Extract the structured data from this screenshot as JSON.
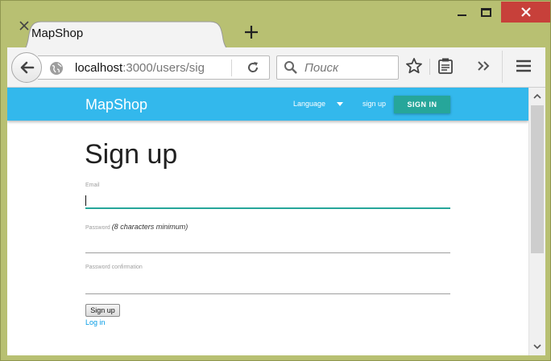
{
  "browser": {
    "tab_title": "MapShop",
    "url_host": "localhost",
    "url_rest": ":3000/users/sig",
    "search_placeholder": "Поиск"
  },
  "site": {
    "brand": "MapShop",
    "nav": {
      "language": "Language",
      "signup": "sign up",
      "signin": "SIGN IN"
    }
  },
  "form": {
    "title": "Sign up",
    "email_label": "Email",
    "password_label": "Password",
    "password_note": "(8 characters minimum)",
    "confirm_label": "Password confirmation",
    "submit_label": "Sign up",
    "login_link": "Log in"
  },
  "colors": {
    "navbar": "#33b8ec",
    "accent": "#26a69a",
    "link": "#039be5",
    "close_button": "#c7403a"
  }
}
